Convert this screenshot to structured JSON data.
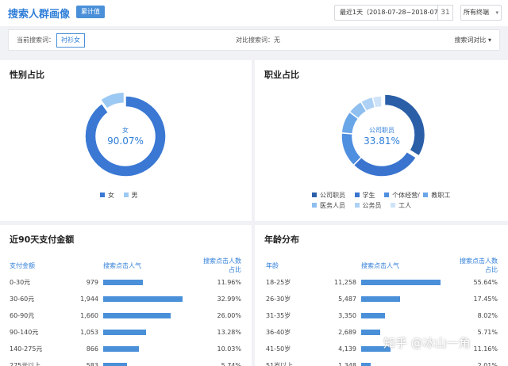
{
  "header": {
    "title": "搜索人群画像",
    "badge": "累计值",
    "date_range": "最近1天（2018-07-28~2018-07-28）",
    "calendar_icon_glyph": "31",
    "terminal": "所有终端",
    "terminal_arrow": "▾"
  },
  "filter": {
    "current_label": "当前搜索词：",
    "current_keyword": "衬衫女",
    "compare_label": "对比搜索词：无",
    "compare_button": "搜索词对比",
    "compare_arrow": "▾"
  },
  "gender": {
    "title": "性别占比",
    "center_label": "女",
    "center_value": "90.07%",
    "slices": [
      {
        "name": "女",
        "value": 90.07,
        "color": "#3a78d4"
      },
      {
        "name": "男",
        "value": 9.93,
        "color": "#9cc9f3"
      }
    ]
  },
  "occupation": {
    "title": "职业占比",
    "center_label": "公司职员",
    "center_value": "33.81%",
    "slices": [
      {
        "name": "公司职员",
        "value": 33.81,
        "color": "#2a5fa8"
      },
      {
        "name": "学生",
        "value": 28.5,
        "color": "#3a74cf"
      },
      {
        "name": "个体经营/服务人员",
        "value": 14.0,
        "color": "#4f8fe0"
      },
      {
        "name": "教职工",
        "value": 9.0,
        "color": "#69a6e8"
      },
      {
        "name": "医务人员",
        "value": 6.0,
        "color": "#8ebfef"
      },
      {
        "name": "公务员",
        "value": 5.0,
        "color": "#add1f4"
      },
      {
        "name": "工人",
        "value": 3.69,
        "color": "#cfe3f8"
      }
    ],
    "legend": [
      "公司职员",
      "学生",
      "个体经营/",
      "教职工",
      "医务人员",
      "公务员",
      "工人"
    ]
  },
  "payment": {
    "title": "近90天支付金额",
    "headers": [
      "支付金额",
      "搜索点击人气",
      "搜索点击人数占比"
    ],
    "rows": [
      {
        "range": "0-30元",
        "pop": "979",
        "pop_value": 979,
        "pct": "11.96%"
      },
      {
        "range": "30-60元",
        "pop": "1,944",
        "pop_value": 1944,
        "pct": "32.99%"
      },
      {
        "range": "60-90元",
        "pop": "1,660",
        "pop_value": 1660,
        "pct": "26.00%"
      },
      {
        "range": "90-140元",
        "pop": "1,053",
        "pop_value": 1053,
        "pct": "13.28%"
      },
      {
        "range": "140-275元",
        "pop": "866",
        "pop_value": 866,
        "pct": "10.03%"
      },
      {
        "range": "275元以上",
        "pop": "583",
        "pop_value": 583,
        "pct": "5.74%"
      }
    ]
  },
  "age": {
    "title": "年龄分布",
    "headers": [
      "年龄",
      "搜索点击人气",
      "搜索点击人数占比"
    ],
    "rows": [
      {
        "range": "18-25岁",
        "pop": "11,258",
        "pop_value": 11258,
        "pct": "55.64%"
      },
      {
        "range": "26-30岁",
        "pop": "5,487",
        "pop_value": 5487,
        "pct": "17.45%"
      },
      {
        "range": "31-35岁",
        "pop": "3,350",
        "pop_value": 3350,
        "pct": "8.02%"
      },
      {
        "range": "36-40岁",
        "pop": "2,689",
        "pop_value": 2689,
        "pct": "5.71%"
      },
      {
        "range": "41-50岁",
        "pop": "4,139",
        "pop_value": 4139,
        "pct": "11.16%"
      },
      {
        "range": "51岁以上",
        "pop": "1,348",
        "pop_value": 1348,
        "pct": "2.01%"
      }
    ]
  },
  "watermark": "知乎 @冰山一角"
}
